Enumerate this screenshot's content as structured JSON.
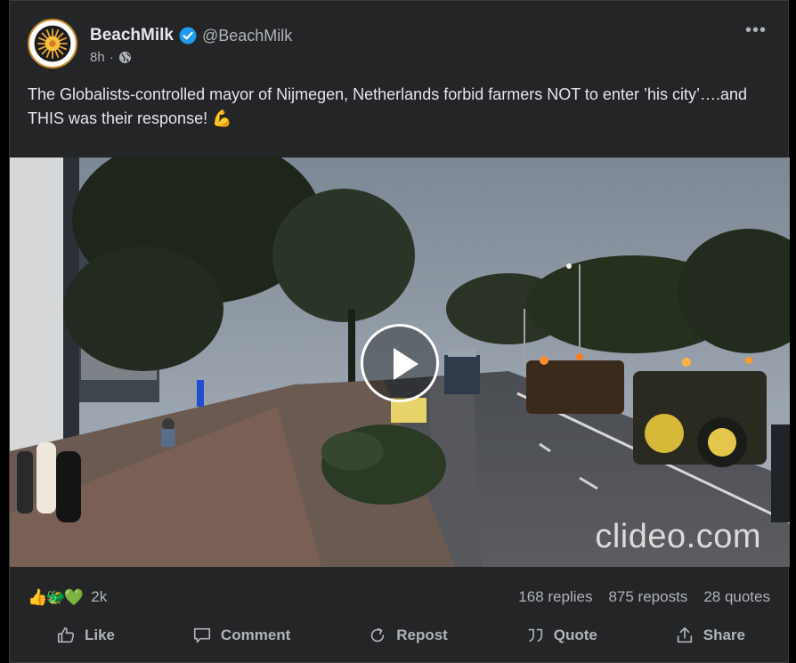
{
  "post": {
    "author_name": "BeachMilk",
    "handle": "@BeachMilk",
    "time": "8h",
    "separator": "·",
    "more_label": "•••",
    "text": "The Globalists-controlled mayor of Nijmegen, Netherlands forbid farmers NOT to enter ’his city’….and THIS was their response! 💪",
    "icons": {
      "verified": "verified-badge-icon",
      "visibility": "globe-icon",
      "more": "more-options-icon"
    },
    "colors": {
      "background": "#242526",
      "text": "#e4e6eb",
      "muted": "#b0b3b8",
      "verified": "#1d9bf0",
      "avatar_ring": "#c78a2a"
    }
  },
  "media": {
    "watermark": "clideo.com",
    "play_icon": "play-icon"
  },
  "stats": {
    "reaction_emojis": [
      "👍",
      "🐲",
      "💚"
    ],
    "reaction_count": "2k",
    "replies": "168 replies",
    "reposts": "875 reposts",
    "quotes": "28 quotes"
  },
  "actions": [
    {
      "label": "Like",
      "icon": "thumbs-up-icon"
    },
    {
      "label": "Comment",
      "icon": "comment-icon"
    },
    {
      "label": "Repost",
      "icon": "repost-icon"
    },
    {
      "label": "Quote",
      "icon": "quote-icon"
    },
    {
      "label": "Share",
      "icon": "share-icon"
    }
  ]
}
